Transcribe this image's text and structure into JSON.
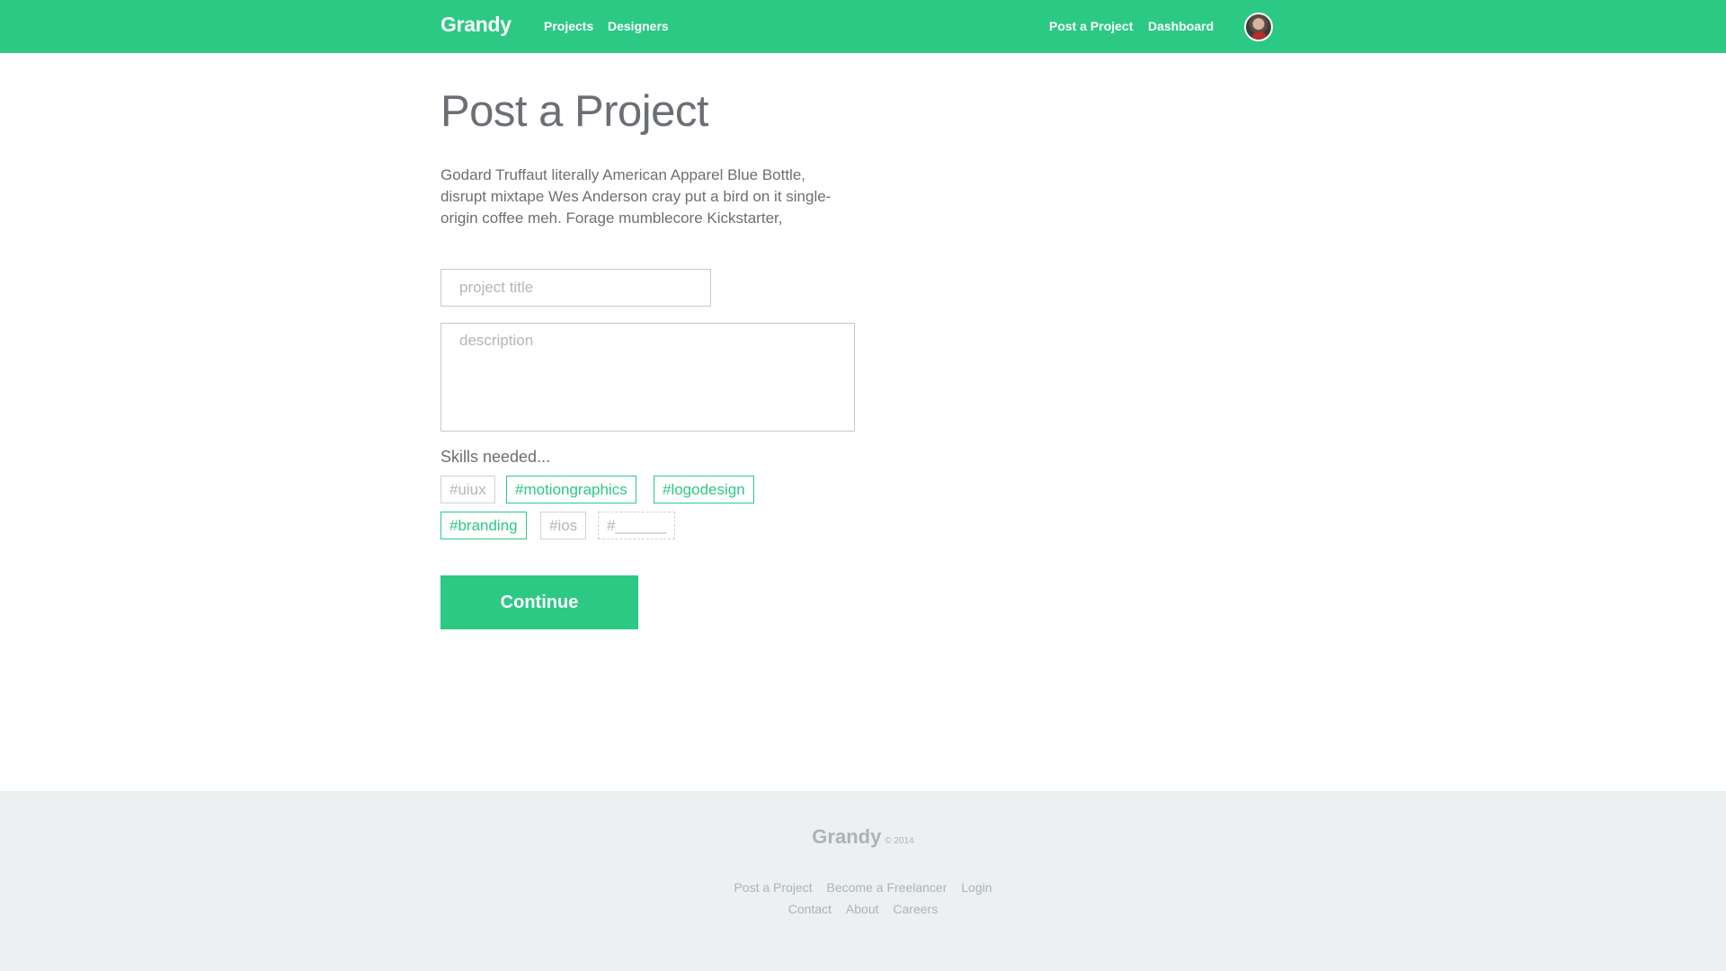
{
  "header": {
    "logo": "Grandy",
    "nav_left": [
      "Projects",
      "Designers"
    ],
    "nav_right": [
      "Post a Project",
      "Dashboard"
    ],
    "brand_color": "#2cc985",
    "avatar_icon": "user-avatar-icon"
  },
  "main": {
    "title": "Post a Project",
    "intro": "Godard Truffaut literally American Apparel Blue Bottle, disrupt mixtape Wes Anderson cray put a bird on it sin­gle-origin coffee meh. Forage mumblecore Kickstarter,",
    "project_title_placeholder": "project title",
    "description_placeholder": "description",
    "skills_label": "Skills needed...",
    "tags": [
      {
        "label": "#uiux",
        "selected": false
      },
      {
        "label": "#motiongraphics",
        "selected": true
      },
      {
        "label": "#logodesign",
        "selected": true
      },
      {
        "label": "#branding",
        "selected": true
      },
      {
        "label": "#ios",
        "selected": false
      },
      {
        "label": "#______",
        "selected": false
      }
    ],
    "continue_label": "Continue"
  },
  "footer": {
    "logo": "Grandy",
    "copyright": "© 2014",
    "row1": [
      "Post a Project",
      "Become a Freelancer",
      "Login"
    ],
    "row2": [
      "Contact",
      "About",
      "Careers"
    ],
    "background": "#ecf0f1"
  }
}
